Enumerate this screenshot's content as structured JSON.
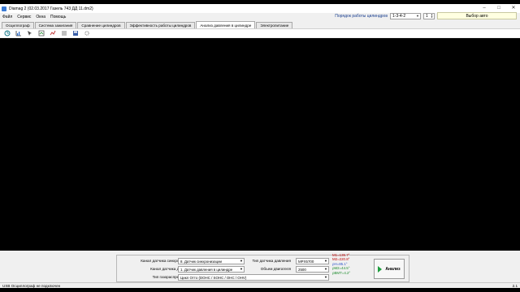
{
  "window": {
    "title": "Diamag 2 (02.03.2017 Газель 743 ДД 11.dm2)"
  },
  "menu": [
    "Файл",
    "Сервис",
    "Окна",
    "Помощь"
  ],
  "firing_order": {
    "label": "Порядок работы цилиндров",
    "value": "1-3-4-2",
    "cylinder": "1",
    "auto_select": "Выбор авто"
  },
  "tabs": [
    {
      "label": "Осциллограф",
      "active": false
    },
    {
      "label": "Система зажигания",
      "active": false
    },
    {
      "label": "Сравнение цилиндров",
      "active": false
    },
    {
      "label": "Эффективность работы цилиндров",
      "active": false
    },
    {
      "label": "Анализ давления в цилиндре",
      "active": true
    },
    {
      "label": "Электропитание",
      "active": false
    }
  ],
  "toolbar": {
    "icons": [
      "sync-icon",
      "chart-icon",
      "cursor-icon",
      "zoom-icon",
      "trend-icon",
      "compare-icon",
      "save-icon",
      "settings-icon"
    ]
  },
  "params": {
    "sync_channel_label": "Канал датчика синхронизации",
    "sync_channel_value": "8. Датчик синхронизации",
    "pressure_channel_label": "Канал датчика давления",
    "pressure_channel_value": "1. Датчик давления в цилиндре",
    "timing_type_label": "Тип газораспределения",
    "timing_type_value": "Цикл Отто (DOHC / SOHC / OHC / OHV)",
    "sensor_type_label": "Тип датчика давления",
    "sensor_type_value": "MPX5700",
    "displacement_label": "Объем двигателя",
    "displacement_value": "2500"
  },
  "readings": [
    {
      "text": "M1=139.7°",
      "color": "#c00000"
    },
    {
      "text": "M2=220.8°",
      "color": "#c00000"
    },
    {
      "text": "ρH=85.1°",
      "color": "#2a52c8"
    },
    {
      "text": "ρM2=44.5°",
      "color": "#1a8a2a"
    },
    {
      "text": "ρBMT=4.2°",
      "color": "#1a8a2a"
    }
  ],
  "analyze_button": "Анализ",
  "status": {
    "left": "USB Осциллограф не подключен",
    "right": "2.1"
  }
}
